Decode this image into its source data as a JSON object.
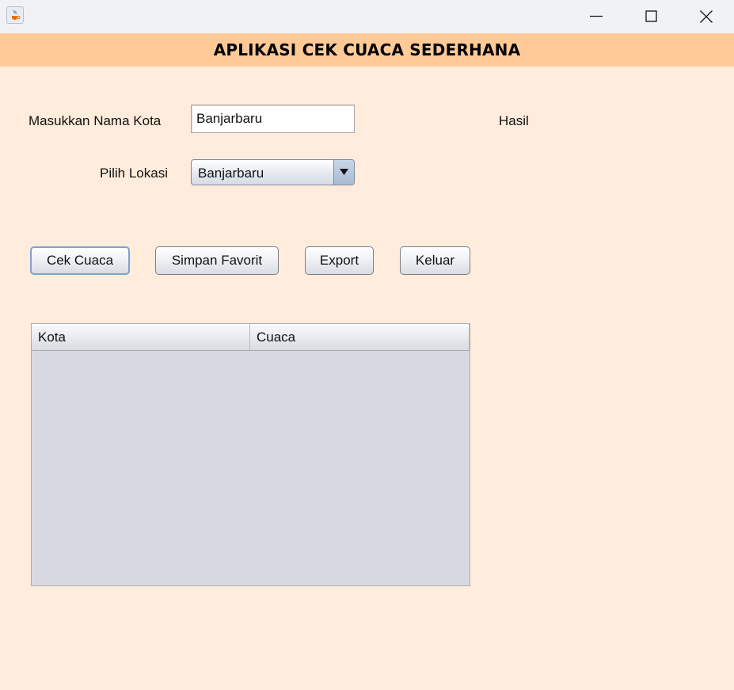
{
  "window": {
    "icon": "java-cup-icon",
    "controls": {
      "minimize": "minimize-icon",
      "maximize": "maximize-icon",
      "close": "close-icon"
    }
  },
  "header": {
    "title": "APLIKASI CEK CUACA SEDERHANA",
    "background": "#ffca98"
  },
  "form": {
    "city_label": "Masukkan Nama Kota",
    "city_value": "Banjarbaru",
    "location_label": "Pilih Lokasi",
    "location_selected": "Banjarbaru",
    "result_label": "Hasil"
  },
  "buttons": {
    "check": "Cek Cuaca",
    "save_favorite": "Simpan Favorit",
    "export": "Export",
    "exit": "Keluar"
  },
  "table": {
    "columns": [
      "Kota",
      "Cuaca"
    ],
    "rows": []
  },
  "colors": {
    "page_background": "#ffecdc",
    "table_background": "#d7d9e0"
  }
}
